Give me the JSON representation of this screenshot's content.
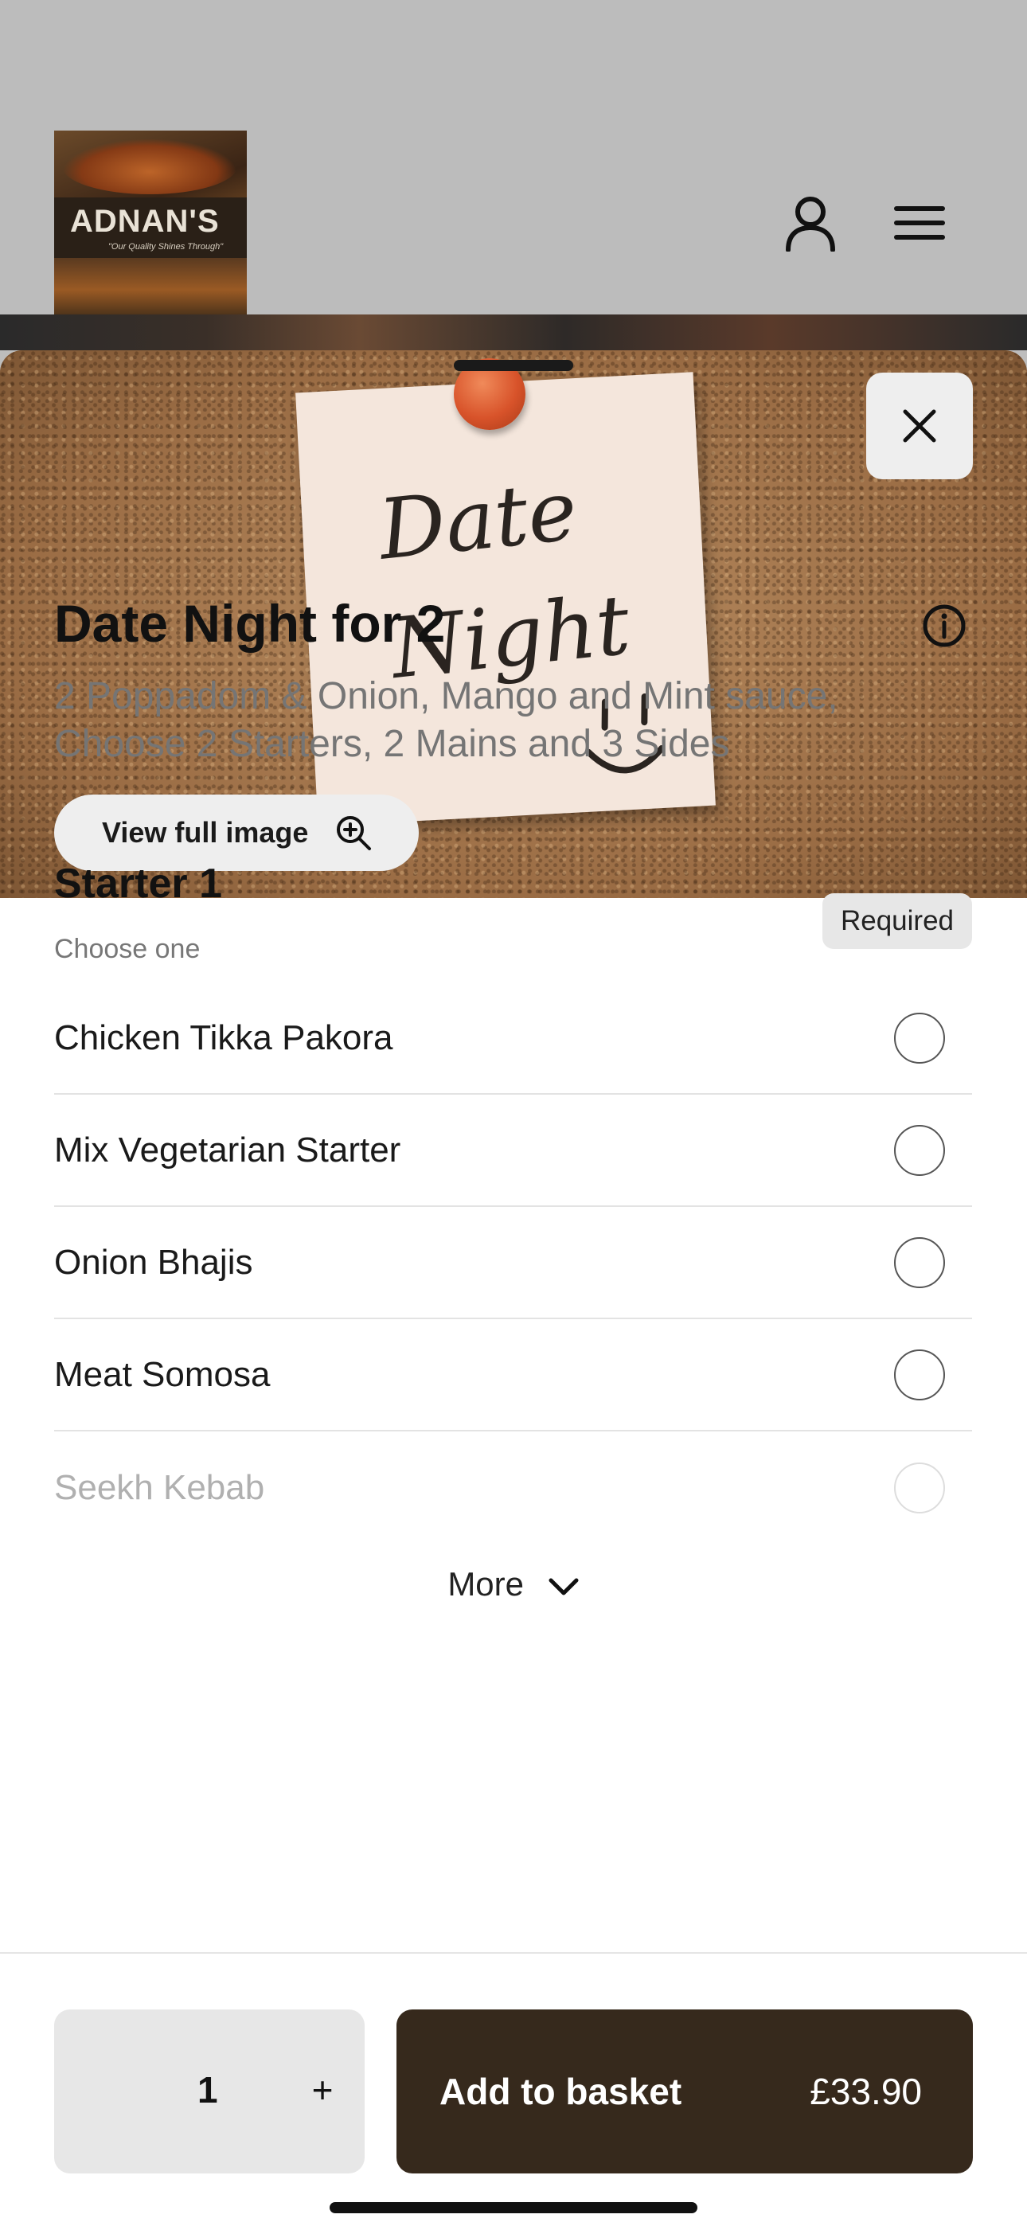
{
  "header": {
    "logo": {
      "brand": "ADNAN'S",
      "tagline": "\"Our Quality Shines Through\""
    },
    "icons": [
      "user-icon",
      "menu-icon"
    ]
  },
  "sheet": {
    "hero": {
      "note_text_line1": "Date",
      "note_text_line2": "Night",
      "view_full_image_label": "View full image"
    },
    "item": {
      "title": "Date Night for 2",
      "description": "2 Poppadom & Onion, Mango and Mint sauce, Choose 2 Starters, 2 Mains and 3 Sides"
    },
    "section": {
      "title": "Starter 1",
      "subtitle": "Choose one",
      "badge": "Required",
      "options": [
        {
          "label": "Chicken Tikka Pakora"
        },
        {
          "label": "Mix Vegetarian Starter"
        },
        {
          "label": "Onion Bhajis"
        },
        {
          "label": "Meat Somosa"
        },
        {
          "label": "Seekh Kebab"
        }
      ],
      "more_label": "More"
    }
  },
  "footer": {
    "quantity": "1",
    "plus_label": "+",
    "add_label": "Add to basket",
    "price": "£33.90"
  },
  "colors": {
    "primary_button": "#36291c",
    "required_badge_bg": "#e7e7e7"
  }
}
